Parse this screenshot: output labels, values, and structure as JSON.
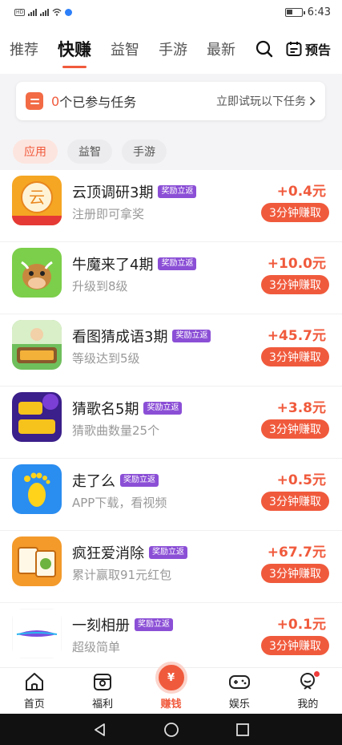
{
  "statusbar": {
    "time": "6:43",
    "left_glyphs": "HD 5G 4G"
  },
  "topnav": {
    "tabs": [
      {
        "label": "推荐"
      },
      {
        "label": "快赚",
        "active": true
      },
      {
        "label": "益智"
      },
      {
        "label": "手游"
      },
      {
        "label": "最新"
      }
    ],
    "preview_label": "预告"
  },
  "joined": {
    "count": "0",
    "text": "个已参与任务",
    "link": "立即试玩以下任务"
  },
  "filters": [
    {
      "label": "应用",
      "active": true
    },
    {
      "label": "益智"
    },
    {
      "label": "手游"
    }
  ],
  "tasks": [
    {
      "title": "云顶调研3期",
      "tag": "奖励立返",
      "desc": "注册即可拿奖",
      "reward": "+0.4元",
      "button": "3分钟赚取",
      "icon": "yunding-app-icon"
    },
    {
      "title": "牛魔来了4期",
      "tag": "奖励立返",
      "desc": "升级到8级",
      "reward": "+10.0元",
      "button": "3分钟赚取",
      "icon": "cow-game-icon"
    },
    {
      "title": "看图猜成语3期",
      "tag": "奖励立返",
      "desc": "等级达到5级",
      "reward": "+45.7元",
      "button": "3分钟赚取",
      "icon": "idiom-game-icon"
    },
    {
      "title": "猜歌名5期",
      "tag": "奖励立返",
      "desc": "猜歌曲数量25个",
      "reward": "+3.8元",
      "button": "3分钟赚取",
      "icon": "song-game-icon"
    },
    {
      "title": "走了么",
      "tag": "奖励立返",
      "desc": "APP下载，看视频",
      "reward": "+0.5元",
      "button": "3分钟赚取",
      "icon": "footprint-app-icon"
    },
    {
      "title": "疯狂爱消除",
      "tag": "奖励立返",
      "desc": "累计赢取91元红包",
      "reward": "+67.7元",
      "button": "3分钟赚取",
      "icon": "mahjong-game-icon"
    },
    {
      "title": "一刻相册",
      "tag": "奖励立返",
      "desc": "超级简单",
      "reward": "+0.1元",
      "button": "3分钟赚取",
      "icon": "album-app-icon"
    }
  ],
  "tabbar": {
    "items": [
      {
        "label": "首页",
        "icon": "home-icon"
      },
      {
        "label": "福利",
        "icon": "welfare-icon"
      },
      {
        "label": "赚钱",
        "icon": "yuan-coin-icon",
        "active": true
      },
      {
        "label": "娱乐",
        "icon": "gamepad-icon"
      },
      {
        "label": "我的",
        "icon": "profile-icon"
      }
    ],
    "center_glyph": "¥"
  },
  "colors": {
    "accent": "#f05a3c",
    "tag": "#8b4fd6",
    "muted": "#999999"
  }
}
